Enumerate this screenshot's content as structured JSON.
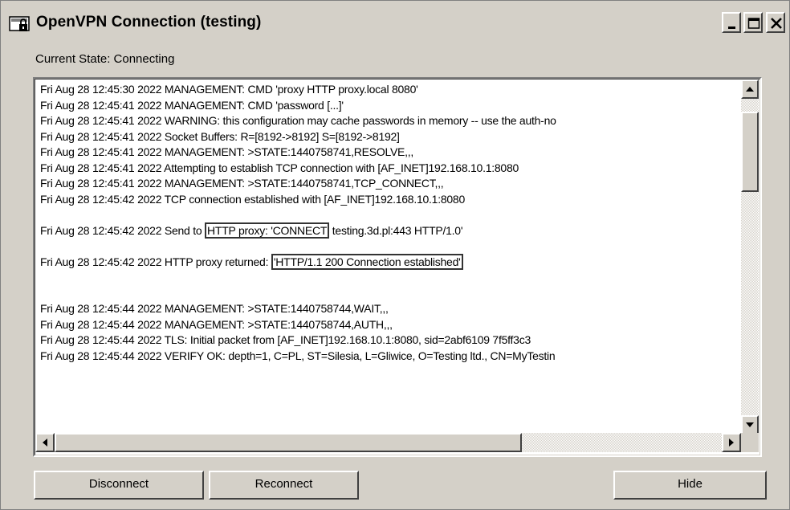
{
  "window": {
    "title": "OpenVPN Connection (testing)"
  },
  "status": {
    "label": "Current State: Connecting"
  },
  "log": [
    {
      "text": "Fri Aug 28 12:45:30 2022 MANAGEMENT: CMD 'proxy HTTP proxy.local 8080'"
    },
    {
      "text": "Fri Aug 28 12:45:41 2022 MANAGEMENT: CMD 'password [...]'"
    },
    {
      "text": "Fri Aug 28 12:45:41 2022 WARNING: this configuration may cache passwords in memory -- use the auth-no"
    },
    {
      "text": "Fri Aug 28 12:45:41 2022 Socket Buffers: R=[8192->8192] S=[8192->8192]"
    },
    {
      "text": "Fri Aug 28 12:45:41 2022 MANAGEMENT: >STATE:1440758741,RESOLVE,,,"
    },
    {
      "text": "Fri Aug 28 12:45:41 2022 Attempting to establish TCP connection with [AF_INET]192.168.10.1:8080"
    },
    {
      "text": "Fri Aug 28 12:45:41 2022 MANAGEMENT: >STATE:1440758741,TCP_CONNECT,,,"
    },
    {
      "text": "Fri Aug 28 12:45:42 2022 TCP connection established with [AF_INET]192.168.10.1:8080"
    },
    {
      "pre": "Fri Aug 28 12:45:42 2022 Send to ",
      "box": "HTTP proxy: 'CONNECT",
      "post": " testing.3d.pl:443 HTTP/1.0'"
    },
    {
      "pre": "Fri Aug 28 12:45:42 2022 HTTP proxy returned: ",
      "box": "'HTTP/1.1 200 Connection established'",
      "post": ""
    },
    {
      "text": "Fri Aug 28 12:45:44 2022 MANAGEMENT: >STATE:1440758744,WAIT,,,"
    },
    {
      "text": "Fri Aug 28 12:45:44 2022 MANAGEMENT: >STATE:1440758744,AUTH,,,"
    },
    {
      "text": "Fri Aug 28 12:45:44 2022 TLS: Initial packet from [AF_INET]192.168.10.1:8080, sid=2abf6109 7f5ff3c3"
    },
    {
      "text": "Fri Aug 28 12:45:44 2022 VERIFY OK: depth=1, C=PL, ST=Silesia, L=Gliwice, O=Testing ltd., CN=MyTestin"
    }
  ],
  "buttons": {
    "disconnect": "Disconnect",
    "reconnect": "Reconnect",
    "hide": "Hide"
  },
  "icons": {
    "title": "openvpn-lock-icon",
    "minimize": "minimize-icon",
    "maximize": "maximize-icon",
    "close": "close-icon"
  }
}
